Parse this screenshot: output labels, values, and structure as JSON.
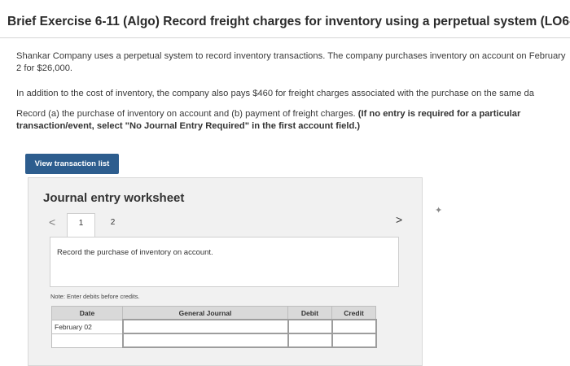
{
  "page": {
    "title": "Brief Exercise 6-11 (Algo) Record freight charges for inventory using a perpetual system (LO6-5)",
    "paragraph1": "Shankar Company uses a perpetual system to record inventory transactions. The company purchases inventory on account on February 2 for $26,000.",
    "paragraph2": "In addition to the cost of inventory, the company also pays $460 for freight charges associated with the purchase on the same da",
    "paragraph3": "Record (a) the purchase of inventory on account and (b) payment of freight charges.",
    "paragraph3_bold": "(If no entry is required for a particular transaction/event, select \"No Journal Entry Required\" in the first account field.)"
  },
  "actions": {
    "view_transaction_list": "View transaction list"
  },
  "worksheet": {
    "title": "Journal entry worksheet",
    "prev_glyph": "<",
    "next_glyph": ">",
    "tabs": [
      {
        "label": "1",
        "active": true
      },
      {
        "label": "2",
        "active": false
      }
    ],
    "instruction": "Record the purchase of inventory on account.",
    "note": "Note: Enter debits before credits.",
    "table": {
      "headers": [
        "Date",
        "General Journal",
        "Debit",
        "Credit"
      ],
      "rows": [
        {
          "date": "February 02",
          "account": "",
          "debit": "",
          "credit": ""
        },
        {
          "date": "",
          "account": "",
          "debit": "",
          "credit": ""
        }
      ]
    }
  },
  "icons": {
    "cursor": "sparkle-cursor-icon"
  }
}
